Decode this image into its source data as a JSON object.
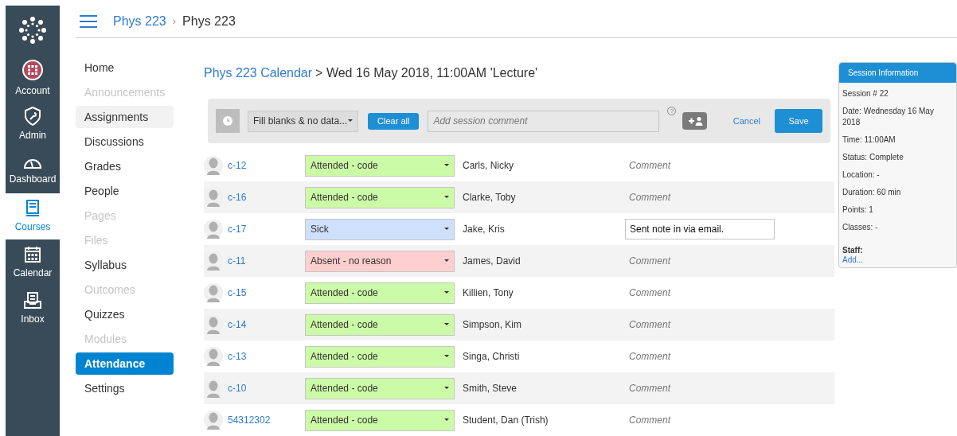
{
  "global_nav": [
    {
      "label": "Account",
      "kind": "account",
      "selected": false
    },
    {
      "label": "Admin",
      "kind": "admin",
      "selected": false
    },
    {
      "label": "Dashboard",
      "kind": "dashboard",
      "selected": false
    },
    {
      "label": "Courses",
      "kind": "courses",
      "selected": true
    },
    {
      "label": "Calendar",
      "kind": "calendar",
      "selected": false
    },
    {
      "label": "Inbox",
      "kind": "inbox",
      "selected": false
    }
  ],
  "breadcrumb_separator": "›",
  "breadcrumb": [
    {
      "label": "Phys 223",
      "link": true
    },
    {
      "label": "Phys 223",
      "link": false
    }
  ],
  "course_nav": [
    {
      "label": "Home",
      "disabled": false,
      "hovered": false,
      "selected": false
    },
    {
      "label": "Announcements",
      "disabled": true,
      "hovered": false,
      "selected": false
    },
    {
      "label": "Assignments",
      "disabled": false,
      "hovered": true,
      "selected": false
    },
    {
      "label": "Discussions",
      "disabled": false,
      "hovered": false,
      "selected": false
    },
    {
      "label": "Grades",
      "disabled": false,
      "hovered": false,
      "selected": false
    },
    {
      "label": "People",
      "disabled": false,
      "hovered": false,
      "selected": false
    },
    {
      "label": "Pages",
      "disabled": true,
      "hovered": false,
      "selected": false
    },
    {
      "label": "Files",
      "disabled": true,
      "hovered": false,
      "selected": false
    },
    {
      "label": "Syllabus",
      "disabled": false,
      "hovered": false,
      "selected": false
    },
    {
      "label": "Outcomes",
      "disabled": true,
      "hovered": false,
      "selected": false
    },
    {
      "label": "Quizzes",
      "disabled": false,
      "hovered": false,
      "selected": false
    },
    {
      "label": "Modules",
      "disabled": true,
      "hovered": false,
      "selected": false
    },
    {
      "label": "Attendance",
      "disabled": false,
      "hovered": false,
      "selected": true
    },
    {
      "label": "Settings",
      "disabled": false,
      "hovered": false,
      "selected": false
    }
  ],
  "title": {
    "link": "Phys 223 Calendar",
    "rest": "> Wed 16 May 2018, 11:00AM 'Lecture'"
  },
  "toolbar": {
    "fill_select": "Fill blanks & no data...",
    "clear_button": "Clear all",
    "comment_placeholder": "Add session comment",
    "help": "?",
    "cancel": "Cancel",
    "save": "Save"
  },
  "students": [
    {
      "id": "c-12",
      "status": "Attended - code",
      "kind": "attended",
      "name": "Carls, Nicky",
      "comment": {
        "placeholder": "Comment"
      }
    },
    {
      "id": "c-16",
      "status": "Attended - code",
      "kind": "attended",
      "name": "Clarke, Toby",
      "comment": {
        "placeholder": "Comment"
      }
    },
    {
      "id": "c-17",
      "status": "Sick",
      "kind": "sick",
      "name": "Jake, Kris",
      "comment": {
        "value": "Sent note in via email."
      }
    },
    {
      "id": "c-11",
      "status": "Absent - no reason",
      "kind": "absent",
      "name": "James, David",
      "comment": {
        "placeholder": "Comment"
      }
    },
    {
      "id": "c-15",
      "status": "Attended - code",
      "kind": "attended",
      "name": "Killien, Tony",
      "comment": {
        "placeholder": "Comment"
      }
    },
    {
      "id": "c-14",
      "status": "Attended - code",
      "kind": "attended",
      "name": "Simpson, Kim",
      "comment": {
        "placeholder": "Comment"
      }
    },
    {
      "id": "c-13",
      "status": "Attended - code",
      "kind": "attended",
      "name": "Singa, Christi",
      "comment": {
        "placeholder": "Comment"
      }
    },
    {
      "id": "c-10",
      "status": "Attended - code",
      "kind": "attended",
      "name": "Smith, Steve",
      "comment": {
        "placeholder": "Comment"
      }
    },
    {
      "id": "54312302",
      "status": "Attended - code",
      "kind": "attended",
      "name": "Student, Dan (Trish)",
      "comment": {
        "placeholder": "Comment"
      }
    }
  ],
  "session_info": {
    "title": "Session Information",
    "lines": [
      "Session # 22",
      "Date: Wednesday 16 May 2018",
      "Time: 11:00AM",
      "Status: Complete",
      "Location: -",
      "Duration: 60 min",
      "Points: 1",
      "Classes: -"
    ],
    "staff_label": "Staff:",
    "staff_link": "Add..."
  }
}
